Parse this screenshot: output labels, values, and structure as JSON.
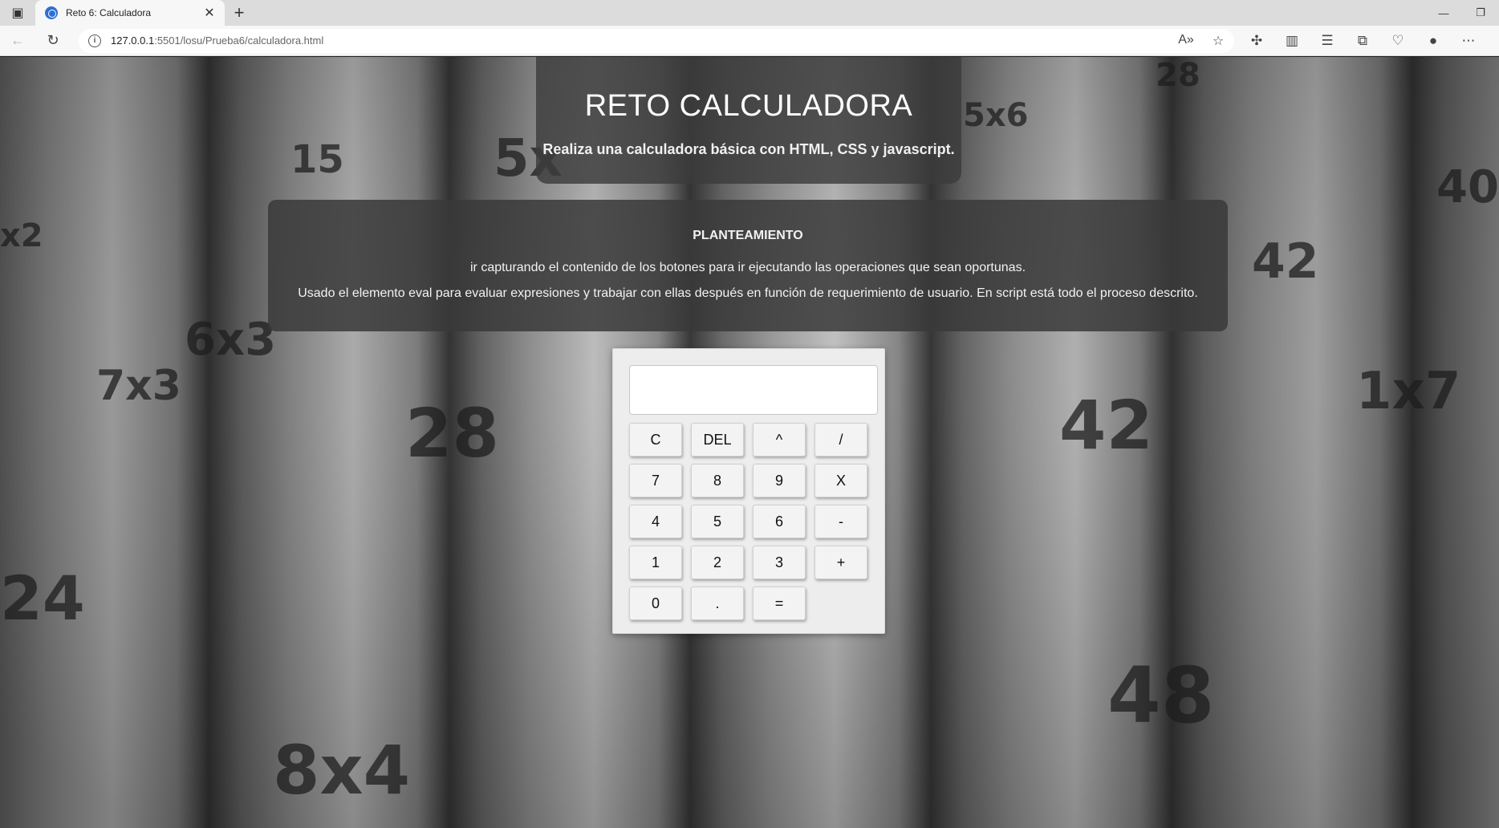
{
  "browser": {
    "tab_title": "Reto 6: Calculadora",
    "url_host": "127.0.0.1",
    "url_rest": ":5501/losu/Prueba6/calculadora.html"
  },
  "header": {
    "title": "RETO CALCULADORA",
    "subtitle": "Realiza una calculadora básica con HTML, CSS y javascript."
  },
  "info": {
    "heading": "PLANTEAMIENTO",
    "line1": "ir capturando el contenido de los botones para ir ejecutando las operaciones que sean oportunas.",
    "line2": "Usado el elemento eval para evaluar expresiones y trabajar con ellas después en función de requerimiento de usuario. En script está todo el proceso descrito."
  },
  "calculator": {
    "display_value": "",
    "keys": [
      "C",
      "DEL",
      "^",
      "/",
      "7",
      "8",
      "9",
      "X",
      "4",
      "5",
      "6",
      "-",
      "1",
      "2",
      "3",
      "+",
      "0",
      ".",
      "="
    ]
  },
  "background_labels": [
    "15",
    "5x",
    "5x6",
    "28",
    "40",
    "x2",
    "42",
    "6x3",
    "7x3",
    "28",
    "42",
    "1x7",
    "24",
    "48",
    "8x4"
  ],
  "colors": {
    "tab_favicon": "#2b6fd6",
    "panel_bg": "rgba(58,58,58,0.85)",
    "calc_bg": "#ededed"
  }
}
